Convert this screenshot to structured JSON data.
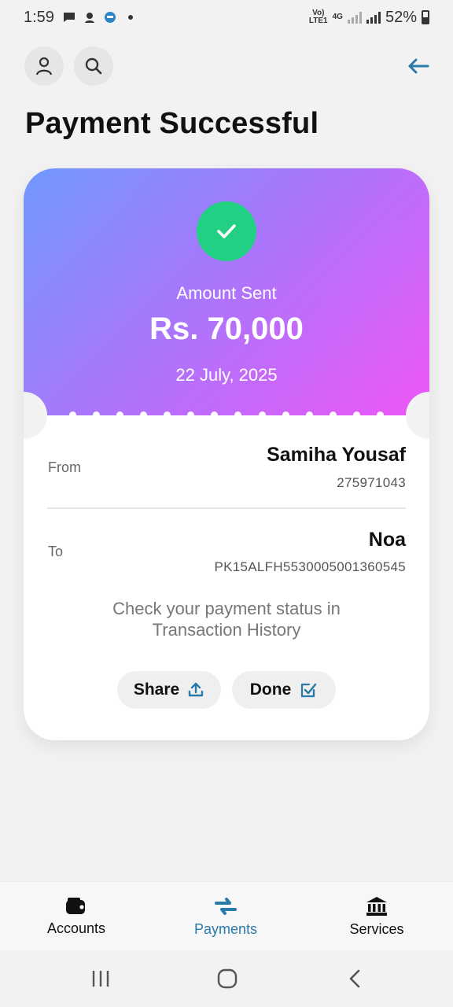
{
  "status_bar": {
    "time": "1:59",
    "network_top": "Vo)",
    "network_bottom": "LTE1",
    "network_type": "4G",
    "battery": "52%"
  },
  "header": {
    "title": "Payment Successful",
    "icons": [
      "user-icon",
      "search-icon",
      "back-arrow-icon"
    ]
  },
  "receipt": {
    "amount_label": "Amount Sent",
    "amount": "Rs. 70,000",
    "date": "22 July, 2025",
    "from_label": "From",
    "from_name": "Samiha Yousaf",
    "from_account": "275971043",
    "to_label": "To",
    "to_name": "Noa",
    "to_account": "PK15ALFH5530005001360545",
    "status_line1": "Check your payment status in",
    "status_line2": "Transaction History",
    "share_label": "Share",
    "done_label": "Done"
  },
  "bottom_nav": {
    "items": [
      {
        "label": "Accounts",
        "icon": "wallet-icon"
      },
      {
        "label": "Payments",
        "icon": "transfer-icon",
        "active": true
      },
      {
        "label": "Services",
        "icon": "bank-icon"
      }
    ]
  },
  "colors": {
    "accent": "#2a7aa9",
    "success": "#21d083",
    "gradient_start": "#7199ff",
    "gradient_end": "#ee56f7"
  }
}
